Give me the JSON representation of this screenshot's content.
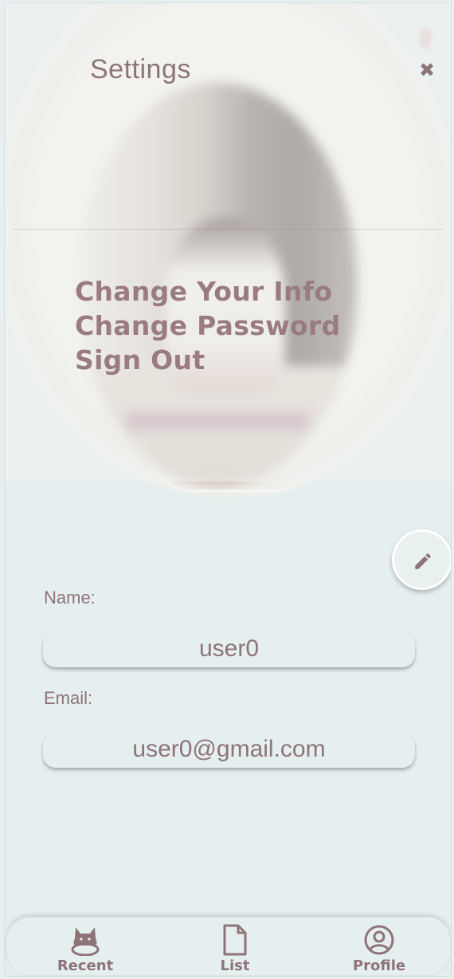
{
  "settings": {
    "title": "Settings",
    "close_icon": "close-icon",
    "menu": [
      {
        "label": "Change Your Info"
      },
      {
        "label": "Change Password"
      },
      {
        "label": "Sign Out"
      }
    ]
  },
  "profile": {
    "edit_icon": "pencil-icon",
    "name_label": "Name:",
    "name_value": "user0",
    "email_label": "Email:",
    "email_value": "user0@gmail.com"
  },
  "nav": {
    "items": [
      {
        "label": "Recent",
        "icon": "cat-icon"
      },
      {
        "label": "List",
        "icon": "document-icon"
      },
      {
        "label": "Profile",
        "icon": "user-circle-icon"
      }
    ]
  },
  "colors": {
    "accent": "#8e7478",
    "background": "#e6eff0"
  }
}
